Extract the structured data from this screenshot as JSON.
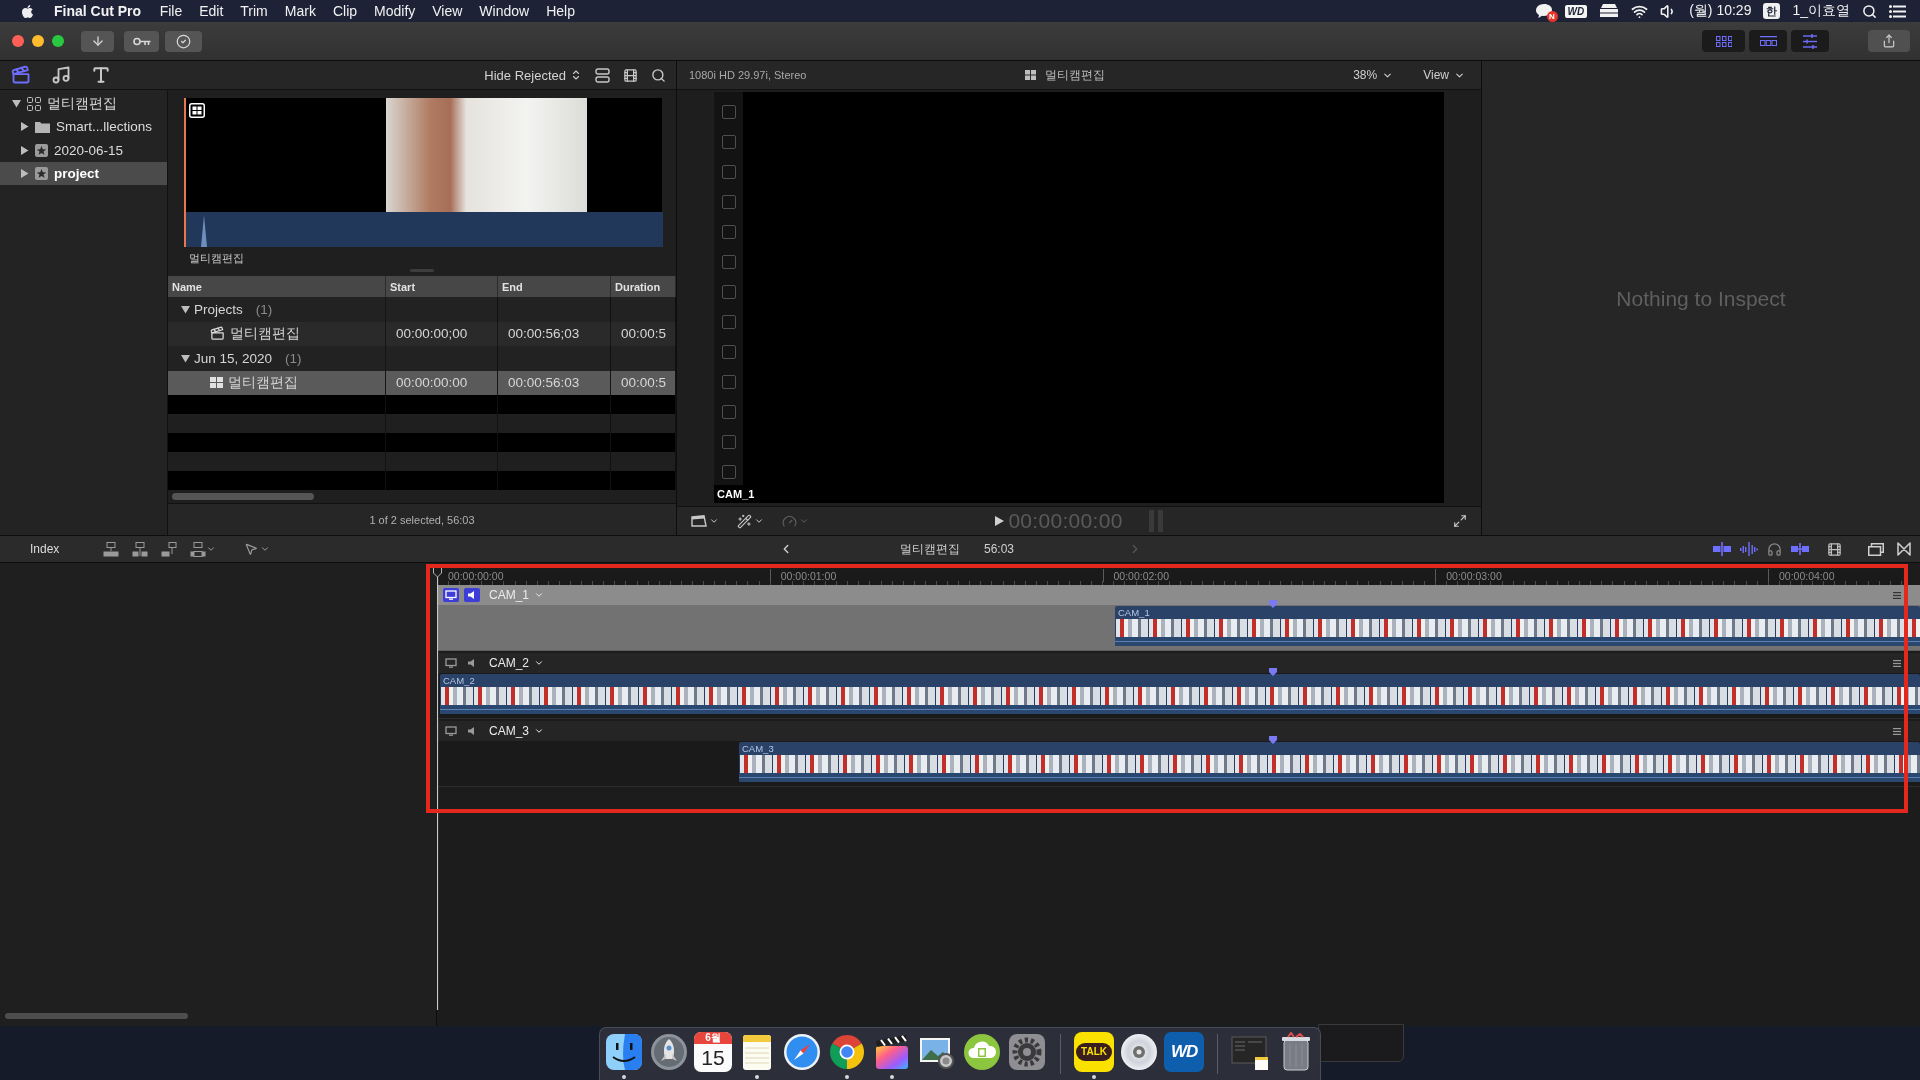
{
  "menu_bar": {
    "app_name": "Final Cut Pro",
    "menus": [
      "File",
      "Edit",
      "Trim",
      "Mark",
      "Clip",
      "Modify",
      "View",
      "Window",
      "Help"
    ],
    "status": {
      "badge": "N",
      "drive": "WD",
      "clock": "(월) 10:29",
      "input_source": "한",
      "user": "1_이효열"
    }
  },
  "toolbar": {
    "workspaces": [
      {
        "kind": "browser",
        "on": true
      },
      {
        "kind": "timeline",
        "on": true
      },
      {
        "kind": "inspector",
        "on": true
      }
    ]
  },
  "browser": {
    "sidebar_tabs": [
      {
        "kind": "libraries",
        "selected": true
      },
      {
        "kind": "photos_audio",
        "selected": false
      },
      {
        "kind": "titles",
        "selected": false
      }
    ],
    "filter": "Hide Rejected",
    "libraries": [
      {
        "kind": "library",
        "label": "멀티캠편집",
        "expanded": true,
        "selected": false,
        "children": [
          {
            "kind": "folder",
            "label": "Smart...llections",
            "expanded": false,
            "selected": false
          },
          {
            "kind": "event",
            "label": "2020-06-15",
            "expanded": false,
            "selected": false
          },
          {
            "kind": "event",
            "label": "project",
            "expanded": false,
            "selected": true
          }
        ]
      }
    ],
    "filmstrip": {
      "label": "멀티캠편집"
    },
    "columns": [
      "Name",
      "Start",
      "End",
      "Duration"
    ],
    "groups": [
      {
        "name": "Projects",
        "count": "(1)",
        "expanded": true,
        "items": [
          {
            "kind": "project",
            "name": "멀티캠편집",
            "start": "00:00:00;00",
            "end": "00:00:56;03",
            "duration": "00:00:5",
            "selected": false
          }
        ]
      },
      {
        "name": "Jun 15, 2020",
        "count": "(1)",
        "expanded": true,
        "items": [
          {
            "kind": "multicam",
            "name": "멀티캠편집",
            "start": "00:00:00:00",
            "end": "00:00:56:03",
            "duration": "00:00:5",
            "selected": true
          }
        ]
      }
    ],
    "status": "1 of 2 selected, 56:03"
  },
  "viewer": {
    "format": "1080i HD 29.97i, Stereo",
    "title": "멀티캠편집",
    "zoom": "38%",
    "view_menu": "View",
    "angle": "CAM_1",
    "timecode": "00:00:00:00",
    "tools": [
      {
        "kind": "view_options",
        "disabled": false
      },
      {
        "kind": "transform",
        "disabled": false
      },
      {
        "kind": "retime",
        "disabled": true
      }
    ]
  },
  "inspector": {
    "message": "Nothing to Inspect"
  },
  "timeline": {
    "index": "Index",
    "navigation": [
      {
        "kind": "back",
        "disabled": false
      },
      {
        "kind": "forward",
        "disabled": true
      }
    ],
    "title": "멀티캠편집",
    "duration": "56:03",
    "toggles": [
      {
        "kind": "video_skimming",
        "on": true
      },
      {
        "kind": "audio_skimming",
        "on": true
      },
      {
        "kind": "solo",
        "on": false
      },
      {
        "kind": "snapping",
        "on": true
      }
    ],
    "ruler": [
      "00:00:00:00",
      "00:00:01:00",
      "00:00:02:00",
      "00:00:03:00",
      "00:00:04:00"
    ],
    "angles": [
      {
        "name": "CAM_1",
        "video_active": true,
        "audio_active": true,
        "clip": {
          "label": "CAM_1"
        }
      },
      {
        "name": "CAM_2",
        "video_active": false,
        "audio_active": false,
        "clip": {
          "label": "CAM_2"
        }
      },
      {
        "name": "CAM_3",
        "video_active": false,
        "audio_active": false,
        "clip": {
          "label": "CAM_3"
        }
      }
    ]
  },
  "dock": [
    {
      "kind": "finder",
      "running": true
    },
    {
      "kind": "launchpad",
      "running": false
    },
    {
      "kind": "calendar",
      "month": "6월",
      "day": "15",
      "running": false
    },
    {
      "kind": "notes",
      "running": true
    },
    {
      "kind": "safari",
      "running": false
    },
    {
      "kind": "chrome",
      "running": true
    },
    {
      "kind": "fcp",
      "running": true
    },
    {
      "kind": "preview",
      "running": false
    },
    {
      "kind": "downloader",
      "running": false
    },
    {
      "kind": "settings",
      "running": false
    },
    {
      "kind": "separator"
    },
    {
      "kind": "chat",
      "label": "TALK",
      "running": true
    },
    {
      "kind": "dvd",
      "running": false
    },
    {
      "kind": "drive",
      "label": "WD",
      "running": false
    },
    {
      "kind": "separator"
    },
    {
      "kind": "stack",
      "running": false
    },
    {
      "kind": "trash",
      "running": false
    }
  ]
}
